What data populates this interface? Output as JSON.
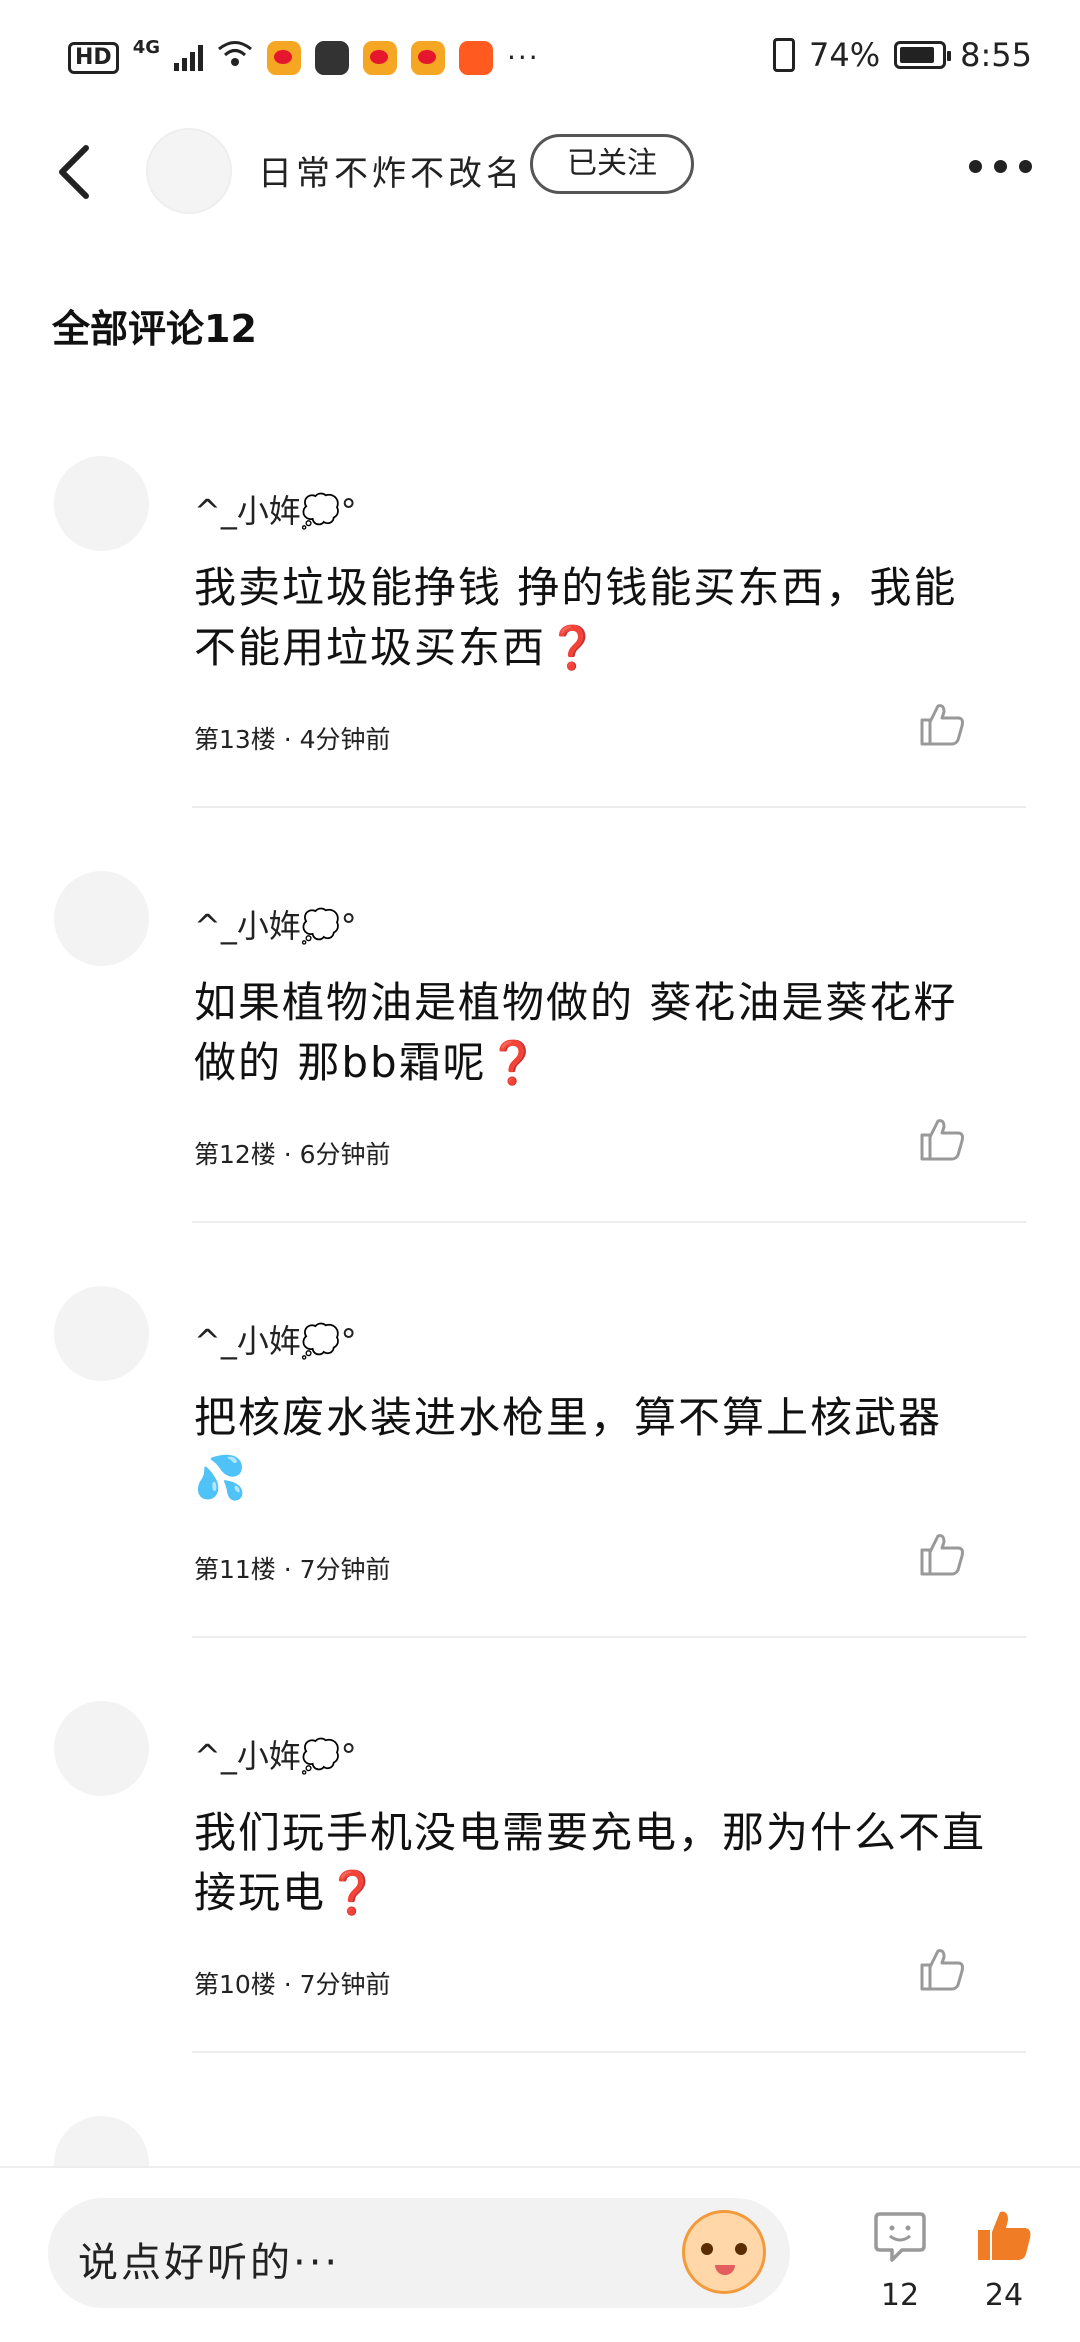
{
  "status_bar": {
    "hd": "HD",
    "network": "4G",
    "more": "···",
    "battery": "74%",
    "time": "8:55"
  },
  "header": {
    "author": "日常不炸不改名",
    "follow_label": "已关注"
  },
  "comments_title": "全部评论12",
  "comments": [
    {
      "user": "^_小姩💭°",
      "text": "我卖垃圾能挣钱 挣的钱能买东西，我能不能用垃圾买东西❓",
      "floor": "第13楼",
      "time": "4分钟前"
    },
    {
      "user": "^_小姩💭°",
      "text": "如果植物油是植物做的 葵花油是葵花籽做的 那bb霜呢❓",
      "floor": "第12楼",
      "time": "6分钟前"
    },
    {
      "user": "^_小姩💭°",
      "text": "把核废水装进水枪里，算不算上核武器💦",
      "floor": "第11楼",
      "time": "7分钟前"
    },
    {
      "user": "^_小姩💭°",
      "text": "我们玩手机没电需要充电，那为什么不直接玩电❓",
      "floor": "第10楼",
      "time": "7分钟前"
    }
  ],
  "bottom": {
    "input_placeholder": "说点好听的···",
    "comment_count": "12",
    "like_count": "24"
  },
  "colors": {
    "like_active": "#f07c26",
    "icon_gray": "#999999"
  }
}
